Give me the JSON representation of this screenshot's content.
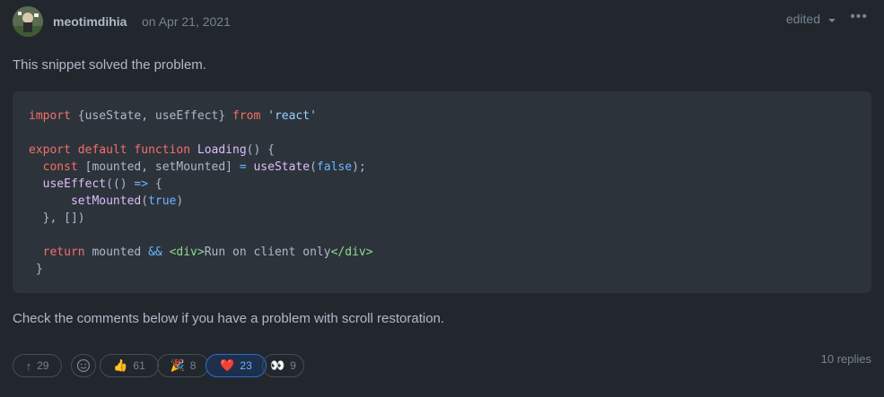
{
  "comment": {
    "author": "meotimdihia",
    "date": "on Apr 21, 2021",
    "edited_label": "edited",
    "more_label": "•••",
    "body_top": "This snippet solved the problem.",
    "body_bottom": "Check the comments below if you have a problem with scroll restoration.",
    "code_lines": [
      "import {useState, useEffect} from 'react'",
      "",
      "export default function Loading() {",
      "  const [mounted, setMounted] = useState(false);",
      "  useEffect(() => {",
      "      setMounted(true)",
      "  }, [])",
      "",
      "  return mounted && <div>Run on client only</div>",
      " }"
    ]
  },
  "reactions": {
    "upvote": {
      "icon": "↑",
      "count": "29"
    },
    "add_reaction": {
      "icon": "smiley-icon"
    },
    "thumbs_up": {
      "emoji": "👍",
      "count": "61"
    },
    "hooray": {
      "emoji": "🎉",
      "count": "8"
    },
    "heart": {
      "emoji": "❤️",
      "count": "23"
    },
    "eyes": {
      "emoji": "👀",
      "count": "9"
    }
  },
  "replies_label": "10 replies"
}
